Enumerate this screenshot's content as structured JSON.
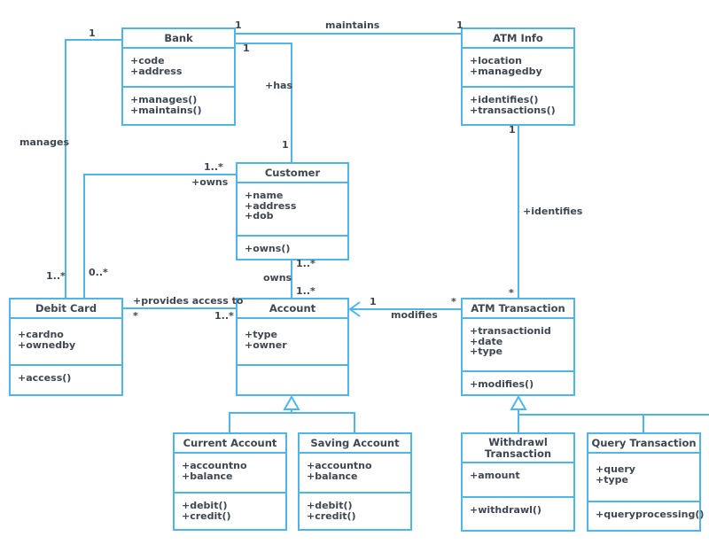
{
  "colors": {
    "line": "#4fb5e8",
    "text": "#3d4752",
    "background": "#ffffff"
  },
  "classes": {
    "bank": {
      "name": "Bank",
      "attributes": [
        "+code",
        "+address"
      ],
      "operations": [
        "+manages()",
        "+maintains()"
      ]
    },
    "atm_info": {
      "name": "ATM Info",
      "attributes": [
        "+location",
        "+managedby"
      ],
      "operations": [
        "+identifies()",
        "+transactions()"
      ]
    },
    "customer": {
      "name": "Customer",
      "attributes": [
        "+name",
        "+address",
        "+dob"
      ],
      "operations": [
        "+owns()"
      ]
    },
    "debit_card": {
      "name": "Debit Card",
      "attributes": [
        "+cardno",
        "+ownedby"
      ],
      "operations": [
        "+access()"
      ]
    },
    "account": {
      "name": "Account",
      "attributes": [
        "+type",
        "+owner"
      ],
      "operations": []
    },
    "atm_transaction": {
      "name": "ATM Transaction",
      "attributes": [
        "+transactionid",
        "+date",
        "+type"
      ],
      "operations": [
        "+modifies()"
      ]
    },
    "current_account": {
      "name": "Current Account",
      "attributes": [
        "+accountno",
        "+balance"
      ],
      "operations": [
        "+debit()",
        "+credit()"
      ]
    },
    "saving_account": {
      "name": "Saving Account",
      "attributes": [
        "+accountno",
        "+balance"
      ],
      "operations": [
        "+debit()",
        "+credit()"
      ]
    },
    "withdrawl_transaction": {
      "name": "Withdrawl Transaction",
      "attributes": [
        "+amount"
      ],
      "operations": [
        "+withdrawl()"
      ]
    },
    "query_transaction": {
      "name": "Query Transaction",
      "attributes": [
        "+query",
        "+type"
      ],
      "operations": [
        "+queryprocessing()"
      ]
    }
  },
  "labels": {
    "maintains": "maintains",
    "maintains_bank_mult": "1",
    "maintains_atm_mult": "1",
    "has": "+has",
    "has_bank_mult": "1",
    "has_customer_mult": "1",
    "manages": "manages",
    "manages_bank_mult": "1",
    "manages_card_mult": "1..*",
    "owns_card": "+owns",
    "owns_card_customer_mult": "1..*",
    "owns_card_card_mult": "0..*",
    "owns_account": "owns",
    "owns_account_customer_mult": "1..*",
    "owns_account_account_mult": "1..*",
    "provides_access": "+provides access to",
    "provides_card_mult": "*",
    "provides_account_mult": "1..*",
    "identifies": "+identifies",
    "identifies_atm_mult": "1",
    "identifies_tx_mult": "*",
    "modifies": "modifies",
    "modifies_account_mult": "1",
    "modifies_tx_mult": "*"
  }
}
